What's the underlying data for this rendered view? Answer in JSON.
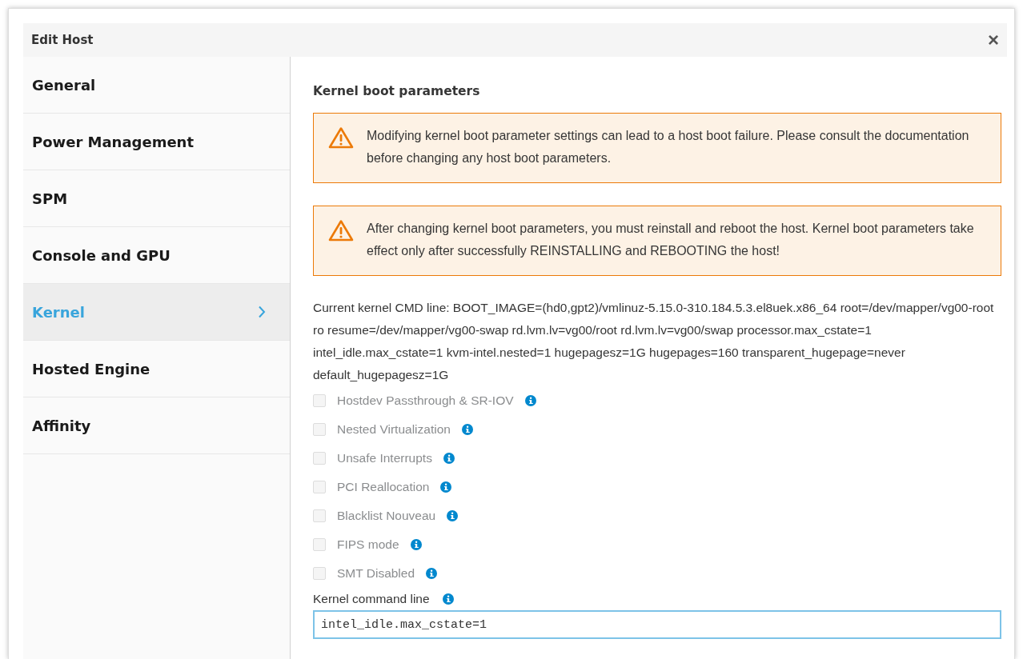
{
  "dialog": {
    "title": "Edit Host",
    "close": "×"
  },
  "sidebar": {
    "items": [
      {
        "label": "General",
        "selected": false
      },
      {
        "label": "Power Management",
        "selected": false
      },
      {
        "label": "SPM",
        "selected": false
      },
      {
        "label": "Console and GPU",
        "selected": false
      },
      {
        "label": "Kernel",
        "selected": true
      },
      {
        "label": "Hosted Engine",
        "selected": false
      },
      {
        "label": "Affinity",
        "selected": false
      }
    ]
  },
  "content": {
    "heading": "Kernel boot parameters",
    "warnings": [
      "Modifying kernel boot parameter settings can lead to a host boot failure. Please consult the documentation before changing any host boot parameters.",
      "After changing kernel boot parameters, you must reinstall and reboot the host. Kernel boot parameters take effect only after successfully REINSTALLING and REBOOTING the host!"
    ],
    "current_cmd_line": "Current kernel CMD line: BOOT_IMAGE=(hd0,gpt2)/vmlinuz-5.15.0-310.184.5.3.el8uek.x86_64 root=/dev/mapper/vg00-root ro resume=/dev/mapper/vg00-swap rd.lvm.lv=vg00/root rd.lvm.lv=vg00/swap processor.max_cstate=1 intel_idle.max_cstate=1 kvm-intel.nested=1 hugepagesz=1G hugepages=160 transparent_hugepage=never default_hugepagesz=1G",
    "options": [
      {
        "label": "Hostdev Passthrough & SR-IOV",
        "checked": false,
        "disabled": true
      },
      {
        "label": "Nested Virtualization",
        "checked": false,
        "disabled": true
      },
      {
        "label": "Unsafe Interrupts",
        "checked": false,
        "disabled": true
      },
      {
        "label": "PCI Reallocation",
        "checked": false,
        "disabled": true
      },
      {
        "label": "Blacklist Nouveau",
        "checked": false,
        "disabled": true
      },
      {
        "label": "FIPS mode",
        "checked": false,
        "disabled": true
      },
      {
        "label": "SMT Disabled",
        "checked": false,
        "disabled": true
      }
    ],
    "cmd_field": {
      "label": "Kernel command line",
      "value": "intel_idle.max_cstate=1"
    }
  }
}
